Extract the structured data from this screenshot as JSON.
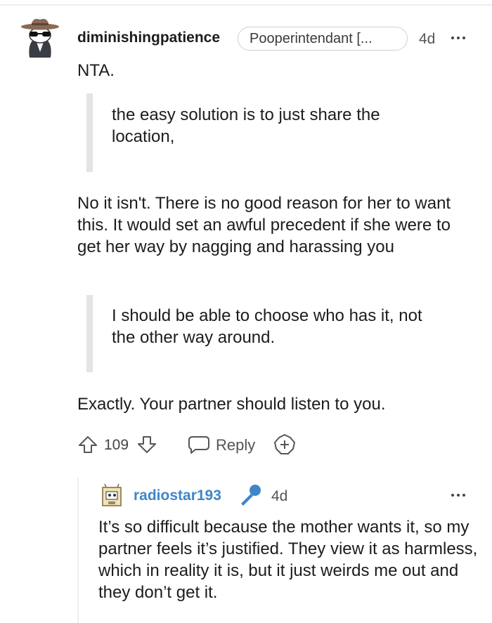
{
  "comment": {
    "username": "diminishingpatience",
    "flair": "Pooperintendant [...",
    "age": "4d",
    "paragraphs": {
      "p1": "NTA.",
      "quote1": "the easy solution is to just share the location,",
      "p2": "No it isn't. There is no good reason for her to want this. It would set an awful precedent if she were to get her way by nagging and harassing you",
      "quote2": "I should be able to choose who has it, not the other way around.",
      "p3": "Exactly. Your partner should listen to you."
    },
    "actions": {
      "score": "109",
      "reply_label": "Reply"
    }
  },
  "reply_comment": {
    "username": "radiostar193",
    "age": "4d",
    "body": "It’s so difficult because the mother wants it, so my partner feels it’s justified. They view it as harmless, which in reality it is, but it just weirds me out and they don’t get it."
  },
  "icons": {
    "avatar": "cowboy-avatar-icon",
    "more": "more-options-icon",
    "upvote": "upvote-arrow-icon",
    "downvote": "downvote-arrow-icon",
    "reply": "speech-bubble-icon",
    "award": "award-icon",
    "avatar2": "boxy-avatar-icon",
    "mic": "microphone-icon"
  },
  "colors": {
    "text": "#1c1c1c",
    "username2": "#3f86c7",
    "mic": "#3f86c7",
    "quote_bar": "#e4e4e4"
  }
}
